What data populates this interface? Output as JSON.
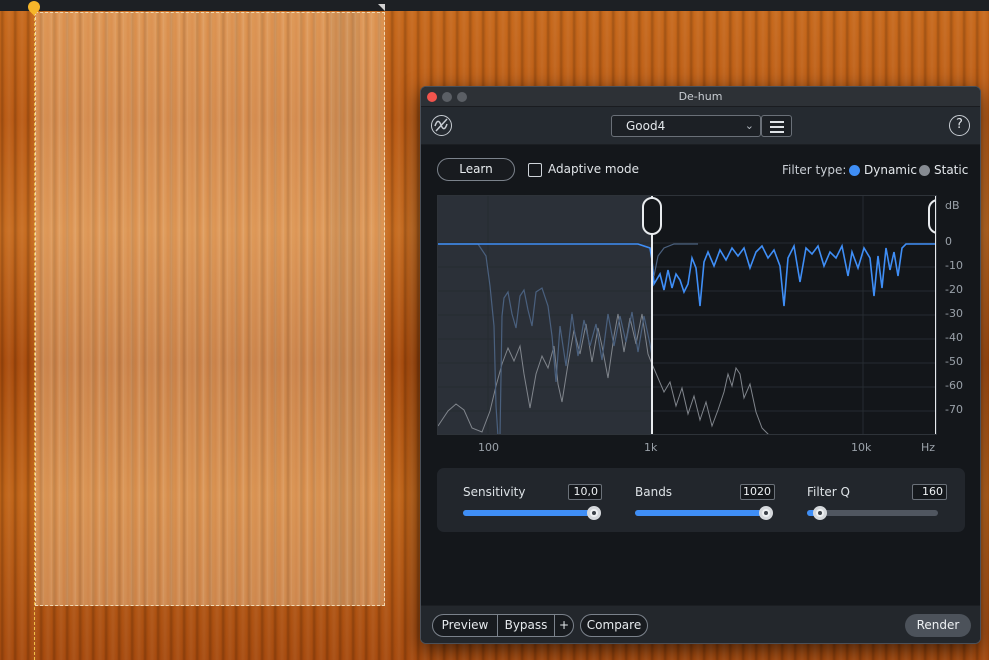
{
  "window": {
    "title": "De-hum"
  },
  "header": {
    "preset_value": "Good4"
  },
  "icons": {
    "logo": "dehum-logo-icon",
    "menu": "hamburger-menu-icon",
    "help": "help-icon",
    "chevron": "chevron-down-icon"
  },
  "toolbar": {
    "learn_label": "Learn",
    "adaptive_label": "Adaptive mode",
    "adaptive_checked": false,
    "filter_type_label": "Filter type:",
    "filter_options": [
      "Dynamic",
      "Static"
    ],
    "filter_selected": "Dynamic"
  },
  "spectrum": {
    "db_unit": "dB",
    "db_ticks": [
      "0",
      "-10",
      "-20",
      "-30",
      "-40",
      "-50",
      "-60",
      "-70"
    ],
    "freq_ticks": [
      "100",
      "1k",
      "10k",
      "Hz"
    ],
    "cutoff_hz": "1k"
  },
  "controls": {
    "sensitivity": {
      "label": "Sensitivity",
      "value": "10,0",
      "level": 1.0
    },
    "bands": {
      "label": "Bands",
      "value": "1020",
      "level": 1.0
    },
    "filter_q": {
      "label": "Filter Q",
      "value": "160",
      "level": 0.1
    }
  },
  "footer": {
    "preview_label": "Preview",
    "bypass_label": "Bypass",
    "plus_label": "+",
    "compare_label": "Compare",
    "render_label": "Render"
  },
  "colors": {
    "accent": "#3f8ef6",
    "waveform_orange": "#c86a1c",
    "close_red": "#f2544d"
  }
}
